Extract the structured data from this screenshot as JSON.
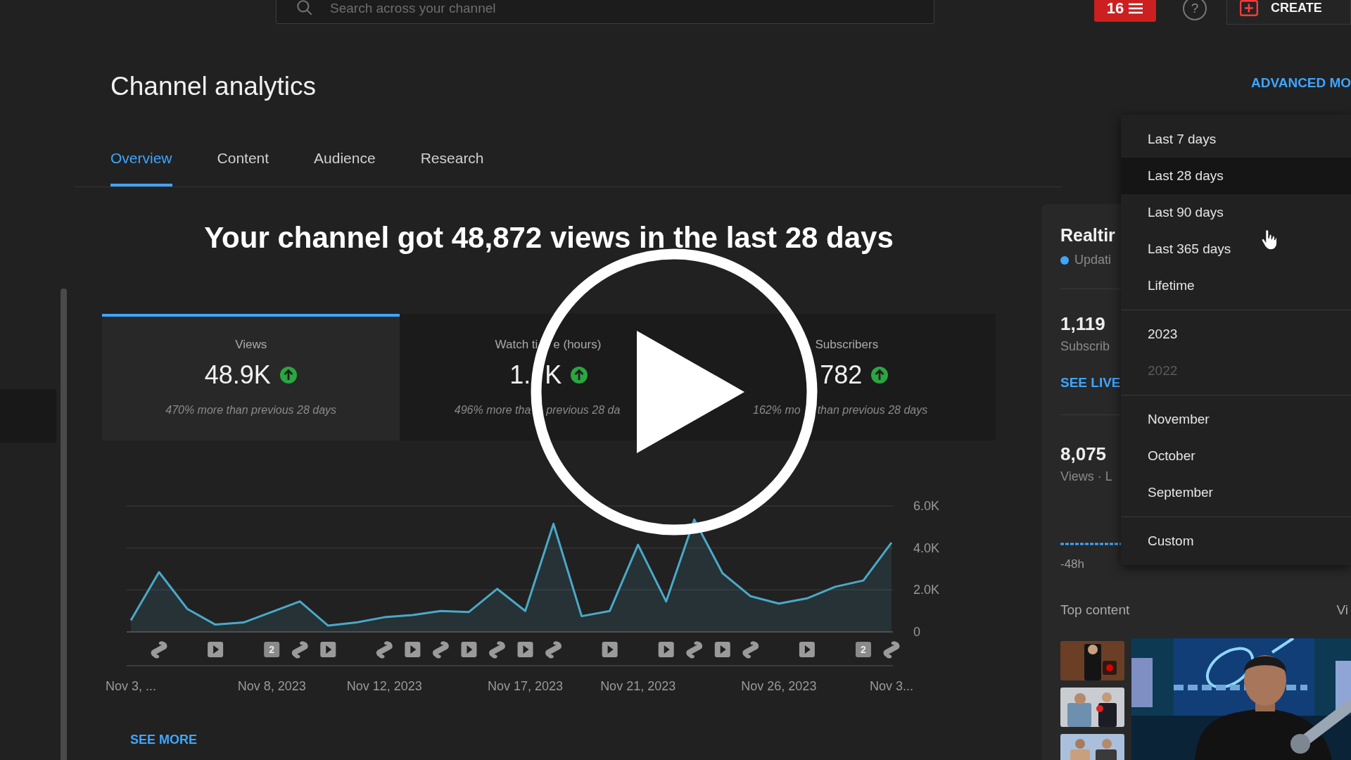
{
  "top_bar": {
    "search": {
      "placeholder": "Search across your channel"
    },
    "notifications": {
      "count": "16"
    },
    "help": "?",
    "create_button": "CREATE"
  },
  "page": {
    "title": "Channel analytics",
    "advanced_mode": "ADVANCED MO"
  },
  "tabs": [
    {
      "label": "Overview",
      "selected": true
    },
    {
      "label": "Content",
      "selected": false
    },
    {
      "label": "Audience",
      "selected": false
    },
    {
      "label": "Research",
      "selected": false
    }
  ],
  "summary": {
    "headline": "Your channel got 48,872 views in the last 28 days"
  },
  "metrics": [
    {
      "label": "Views",
      "value": "48.9K",
      "trend_up": true,
      "note": "470% more than previous 28 days",
      "selected": true
    },
    {
      "label": [
        "Watch ti",
        "e (hours)"
      ],
      "value": [
        "1.",
        "K"
      ],
      "trend_up": true,
      "note": [
        "496% more tha",
        "previous 28 da"
      ],
      "selected": false
    },
    {
      "label": "Subscribers",
      "value": "782",
      "trend_up": true,
      "note": [
        "162% mo",
        "than previous 28 days"
      ],
      "selected": false
    }
  ],
  "chart_data": {
    "type": "area",
    "categories": [
      "Nov 3, ...",
      null,
      null,
      null,
      null,
      "Nov 8, 2023",
      null,
      null,
      null,
      "Nov 12, 2023",
      null,
      null,
      null,
      null,
      "Nov 17, 2023",
      null,
      null,
      null,
      "Nov 21, 2023",
      null,
      null,
      null,
      null,
      "Nov 26, 2023",
      null,
      null,
      null,
      "Nov 3..."
    ],
    "series": [
      {
        "color": "#4aa9c9",
        "values": [
          550,
          2850,
          1100,
          350,
          450,
          950,
          1450,
          300,
          450,
          700,
          800,
          1000,
          950,
          2050,
          1000,
          5150,
          750,
          1000,
          4150,
          1450,
          5350,
          2800,
          1700,
          1350,
          1600,
          2150,
          2450,
          4250
        ]
      }
    ],
    "ylim": [
      0,
      6000
    ],
    "yticks": [
      {
        "value": 0,
        "label": "0"
      },
      {
        "value": 2000,
        "label": "2.0K"
      },
      {
        "value": 4000,
        "label": "4.0K"
      },
      {
        "value": 6000,
        "label": "6.0K"
      }
    ]
  },
  "day_markers": [
    {
      "kind": "none"
    },
    {
      "kind": "short"
    },
    {
      "kind": "none"
    },
    {
      "kind": "video"
    },
    {
      "kind": "none"
    },
    {
      "kind": "count",
      "label": "2"
    },
    {
      "kind": "short"
    },
    {
      "kind": "video"
    },
    {
      "kind": "none"
    },
    {
      "kind": "short"
    },
    {
      "kind": "video"
    },
    {
      "kind": "short"
    },
    {
      "kind": "video"
    },
    {
      "kind": "short"
    },
    {
      "kind": "video"
    },
    {
      "kind": "short"
    },
    {
      "kind": "none"
    },
    {
      "kind": "video"
    },
    {
      "kind": "none"
    },
    {
      "kind": "video"
    },
    {
      "kind": "short"
    },
    {
      "kind": "video"
    },
    {
      "kind": "short"
    },
    {
      "kind": "none"
    },
    {
      "kind": "video"
    },
    {
      "kind": "none"
    },
    {
      "kind": "count",
      "label": "2"
    },
    {
      "kind": "short"
    }
  ],
  "see_more": "SEE MORE",
  "realtime": {
    "title": "Realtir",
    "status": "Updati",
    "subscribers": "1,119",
    "subscribers_label": "Subscrib",
    "see_live": "SEE LIVE",
    "views": "8,075",
    "views_label": "Views · L",
    "axis_start": "-48h"
  },
  "top_content": {
    "title": "Top content",
    "column": "Vi"
  },
  "date_menu": {
    "groups": [
      [
        {
          "label": "Last 7 days",
          "selected": false,
          "disabled": false
        },
        {
          "label": "Last 28 days",
          "selected": true,
          "disabled": false
        },
        {
          "label": "Last 90 days",
          "selected": false,
          "disabled": false
        },
        {
          "label": "Last 365 days",
          "selected": false,
          "disabled": false
        },
        {
          "label": "Lifetime",
          "selected": false,
          "disabled": false
        }
      ],
      [
        {
          "label": "2023",
          "selected": false,
          "disabled": false
        },
        {
          "label": "2022",
          "selected": false,
          "disabled": true
        }
      ],
      [
        {
          "label": "November",
          "selected": false,
          "disabled": false
        },
        {
          "label": "October",
          "selected": false,
          "disabled": false
        },
        {
          "label": "September",
          "selected": false,
          "disabled": false
        }
      ],
      [
        {
          "label": "Custom",
          "selected": false,
          "disabled": false
        }
      ]
    ]
  }
}
